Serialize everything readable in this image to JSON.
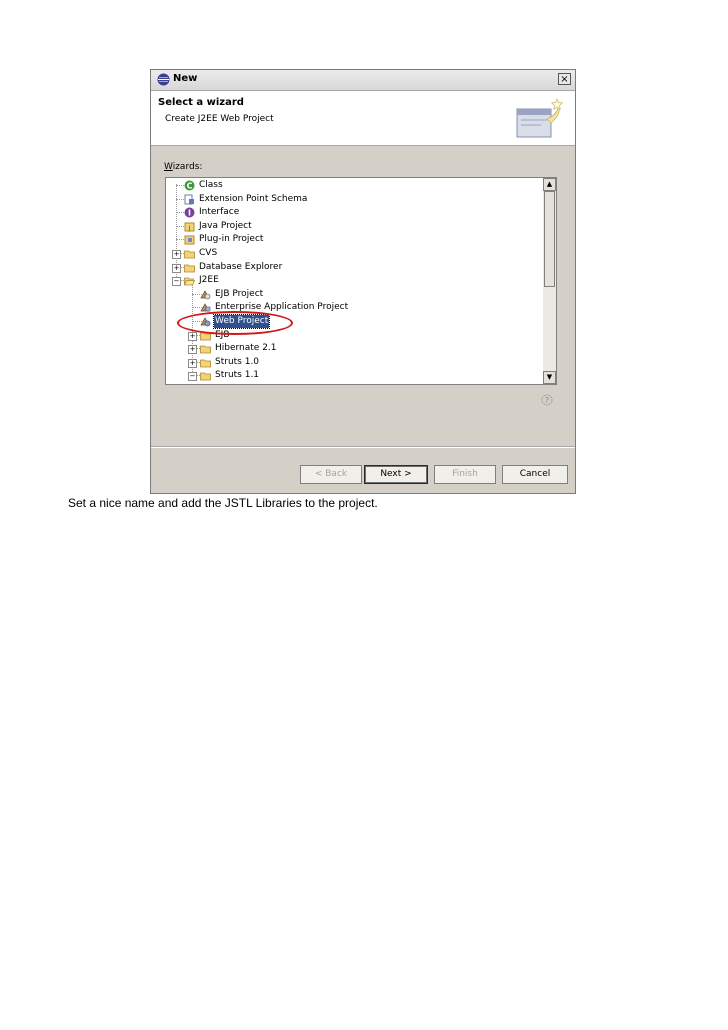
{
  "dialog": {
    "title": "New",
    "close_label": "×",
    "header_title": "Select a wizard",
    "header_description": "Create J2EE Web Project",
    "wizards_label_accel": "W",
    "wizards_label_rest": "izards:"
  },
  "tree": {
    "items": [
      {
        "label": "Class",
        "icon": "class-icon",
        "level": 1,
        "expander": ""
      },
      {
        "label": "Extension Point Schema",
        "icon": "schema-icon",
        "level": 1,
        "expander": ""
      },
      {
        "label": "Interface",
        "icon": "interface-icon",
        "level": 1,
        "expander": ""
      },
      {
        "label": "Java Project",
        "icon": "java-project-icon",
        "level": 1,
        "expander": ""
      },
      {
        "label": "Plug-in Project",
        "icon": "plugin-project-icon",
        "level": 1,
        "expander": ""
      },
      {
        "label": "CVS",
        "icon": "folder-icon",
        "level": 1,
        "expander": "+"
      },
      {
        "label": "Database Explorer",
        "icon": "folder-icon",
        "level": 1,
        "expander": "+"
      },
      {
        "label": "J2EE",
        "icon": "folder-open-icon",
        "level": 1,
        "expander": "−"
      },
      {
        "label": "EJB Project",
        "icon": "ejb-project-icon",
        "level": 2,
        "expander": ""
      },
      {
        "label": "Enterprise Application Project",
        "icon": "ear-project-icon",
        "level": 2,
        "expander": ""
      },
      {
        "label": "Web Project",
        "icon": "web-project-icon",
        "level": 2,
        "expander": "",
        "selected": true
      },
      {
        "label": "EJB",
        "icon": "folder-icon",
        "level": 2,
        "expander": "+"
      },
      {
        "label": "Hibernate 2.1",
        "icon": "folder-icon",
        "level": 2,
        "expander": "+"
      },
      {
        "label": "Struts 1.0",
        "icon": "folder-icon",
        "level": 2,
        "expander": "+"
      },
      {
        "label": "Struts 1.1",
        "icon": "folder-icon",
        "level": 2,
        "expander": "−"
      }
    ]
  },
  "buttons": {
    "back": "< Back",
    "next": "Next >",
    "finish": "Finish",
    "cancel": "Cancel"
  },
  "colors": {
    "selection": "#2f4f8f",
    "highlight_circle": "#d01818"
  },
  "caption": "Set a nice name and add the JSTL Libraries to the project."
}
